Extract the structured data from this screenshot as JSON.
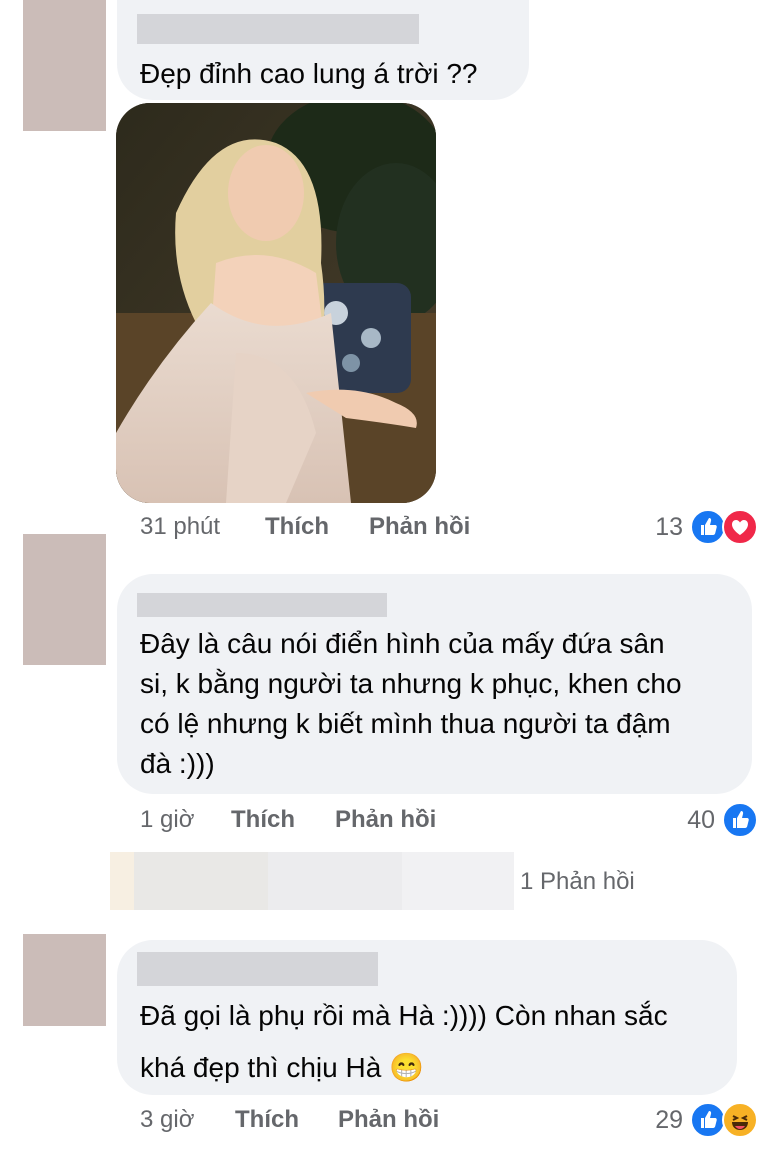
{
  "comments": [
    {
      "text": "Đẹp đỉnh cao lung á trời ??",
      "time": "31 phút",
      "like_label": "Thích",
      "reply_label": "Phản hồi",
      "reaction_count": "13",
      "reactions": [
        "like-icon",
        "love-icon"
      ]
    },
    {
      "text": "Đây là câu nói điển hình của mấy đứa sân\nsi, k bằng người ta nhưng k phục, khen cho\ncó lệ nhưng k biết mình thua người ta đậm\nđà :)))",
      "time": "1 giờ",
      "like_label": "Thích",
      "reply_label": "Phản hồi",
      "reaction_count": "40",
      "reactions": [
        "like-icon"
      ],
      "replies_link": "1 Phản hồi"
    },
    {
      "text": "Đã gọi là phụ rồi mà Hà :)))) Còn nhan sắc\nkhá đẹp thì chịu Hà 😁",
      "time": "3 giờ",
      "like_label": "Thích",
      "reply_label": "Phản hồi",
      "reaction_count": "29",
      "reactions": [
        "like-icon",
        "haha-icon"
      ]
    }
  ],
  "colors": {
    "bubble": "#f0f2f5",
    "meta_text": "#65676b",
    "like_blue": "#1877f2",
    "love_red": "#f02849",
    "haha_yellow": "#f7b125"
  }
}
